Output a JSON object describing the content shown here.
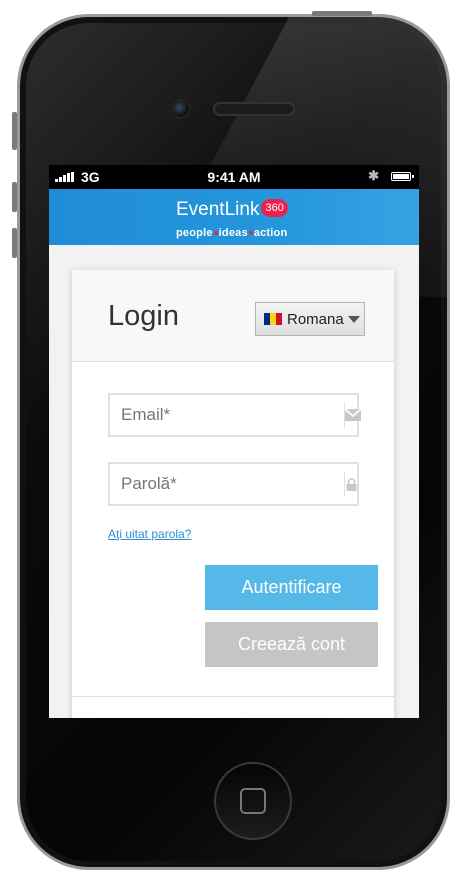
{
  "status_bar": {
    "carrier": "3G",
    "time": "9:41 AM"
  },
  "header": {
    "logo_text": "EventLink",
    "logo_badge": "360",
    "tagline": [
      "people",
      "ideas",
      "action"
    ],
    "colors": {
      "header_blue": "#1f8dd6",
      "accent_red": "#e8244f"
    }
  },
  "login": {
    "title": "Login",
    "language": {
      "selected": "Romana",
      "flag": "romania-flag"
    },
    "email_placeholder": "Email*",
    "password_placeholder": "Parolă*",
    "forgot_link": "Aţi uitat parola?",
    "login_button": "Autentificare",
    "create_button": "Creează cont",
    "colors": {
      "primary_button": "#55b8e8",
      "secondary_button": "#c5c5c5",
      "link": "#2a8fd5"
    }
  },
  "icons": {
    "email": "envelope-icon",
    "password": "lock-icon",
    "bluetooth": "bluetooth-icon",
    "battery": "battery-icon",
    "signal": "signal-icon"
  }
}
